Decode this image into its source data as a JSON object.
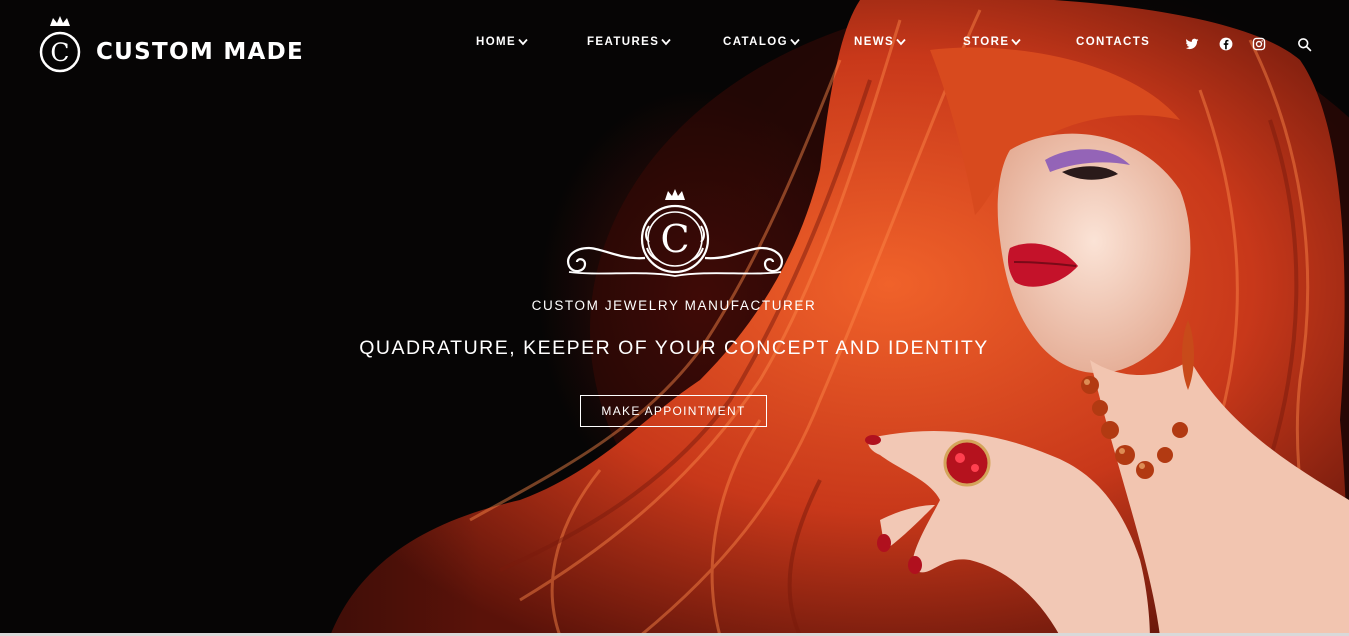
{
  "header": {
    "brand_initial": "C",
    "brand_name": "CUSTOM MADE",
    "nav": [
      {
        "label": "HOME"
      },
      {
        "label": "FEATURES"
      },
      {
        "label": "CATALOG"
      },
      {
        "label": "NEWS"
      },
      {
        "label": "STORE"
      },
      {
        "label": "CONTACTS"
      }
    ],
    "social_icons": [
      "twitter-icon",
      "facebook-icon",
      "instagram-icon"
    ],
    "search_icon": "search-icon"
  },
  "hero": {
    "emblem_initial": "C",
    "subtitle": "CUSTOM JEWELRY MANUFACTURER",
    "headline": "QUADRATURE, KEEPER OF YOUR CONCEPT AND IDENTITY",
    "cta_label": "MAKE APPOINTMENT"
  },
  "colors": {
    "background": "#050505",
    "hair": "#d8461c",
    "lips": "#c4122a",
    "text": "#ffffff"
  }
}
